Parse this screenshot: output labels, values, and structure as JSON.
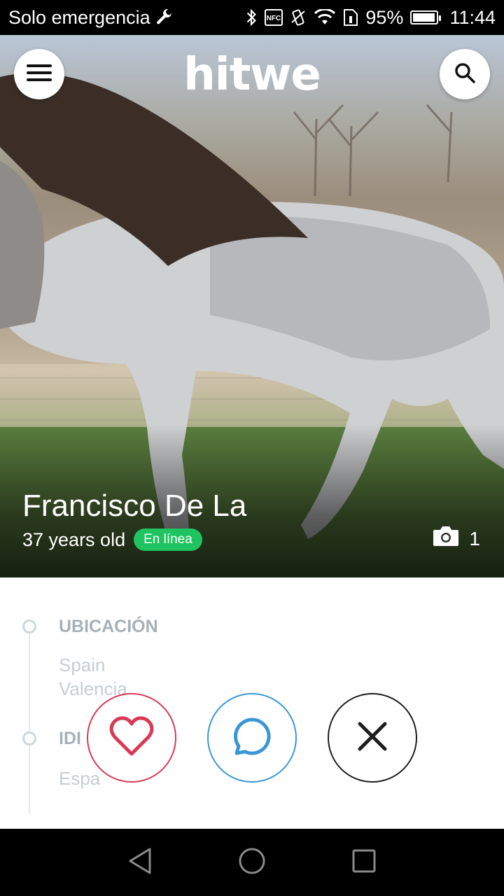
{
  "status_bar": {
    "carrier": "Solo emergencia",
    "battery_percent": "95%",
    "battery_level": 0.95,
    "time": "11:44",
    "icons": [
      "wrench-icon",
      "bluetooth-icon",
      "nfc-icon",
      "vibrate-icon",
      "wifi-icon",
      "sim-icon",
      "battery-icon"
    ]
  },
  "header": {
    "logo": "hitwe",
    "menu_icon": "hamburger-icon",
    "search_icon": "search-icon"
  },
  "profile": {
    "name": "Francisco De La",
    "age": "37 years old",
    "status_badge": "En línea",
    "photo_count": "1",
    "photo_icon": "camera-icon"
  },
  "details": {
    "location_title": "UBICACIÓN",
    "location_country": "Spain",
    "location_city": "Valencia",
    "language_title": "IDI",
    "language_value": "Espa"
  },
  "actions": {
    "like_icon": "heart-icon",
    "chat_icon": "chat-bubble-icon",
    "skip_icon": "close-icon"
  },
  "colors": {
    "like": "#d83a56",
    "chat": "#3a97d4",
    "skip": "#1d1d1d",
    "online": "#1fc460"
  },
  "nav": {
    "back_icon": "back-icon",
    "home_icon": "home-icon",
    "recents_icon": "recents-icon"
  }
}
